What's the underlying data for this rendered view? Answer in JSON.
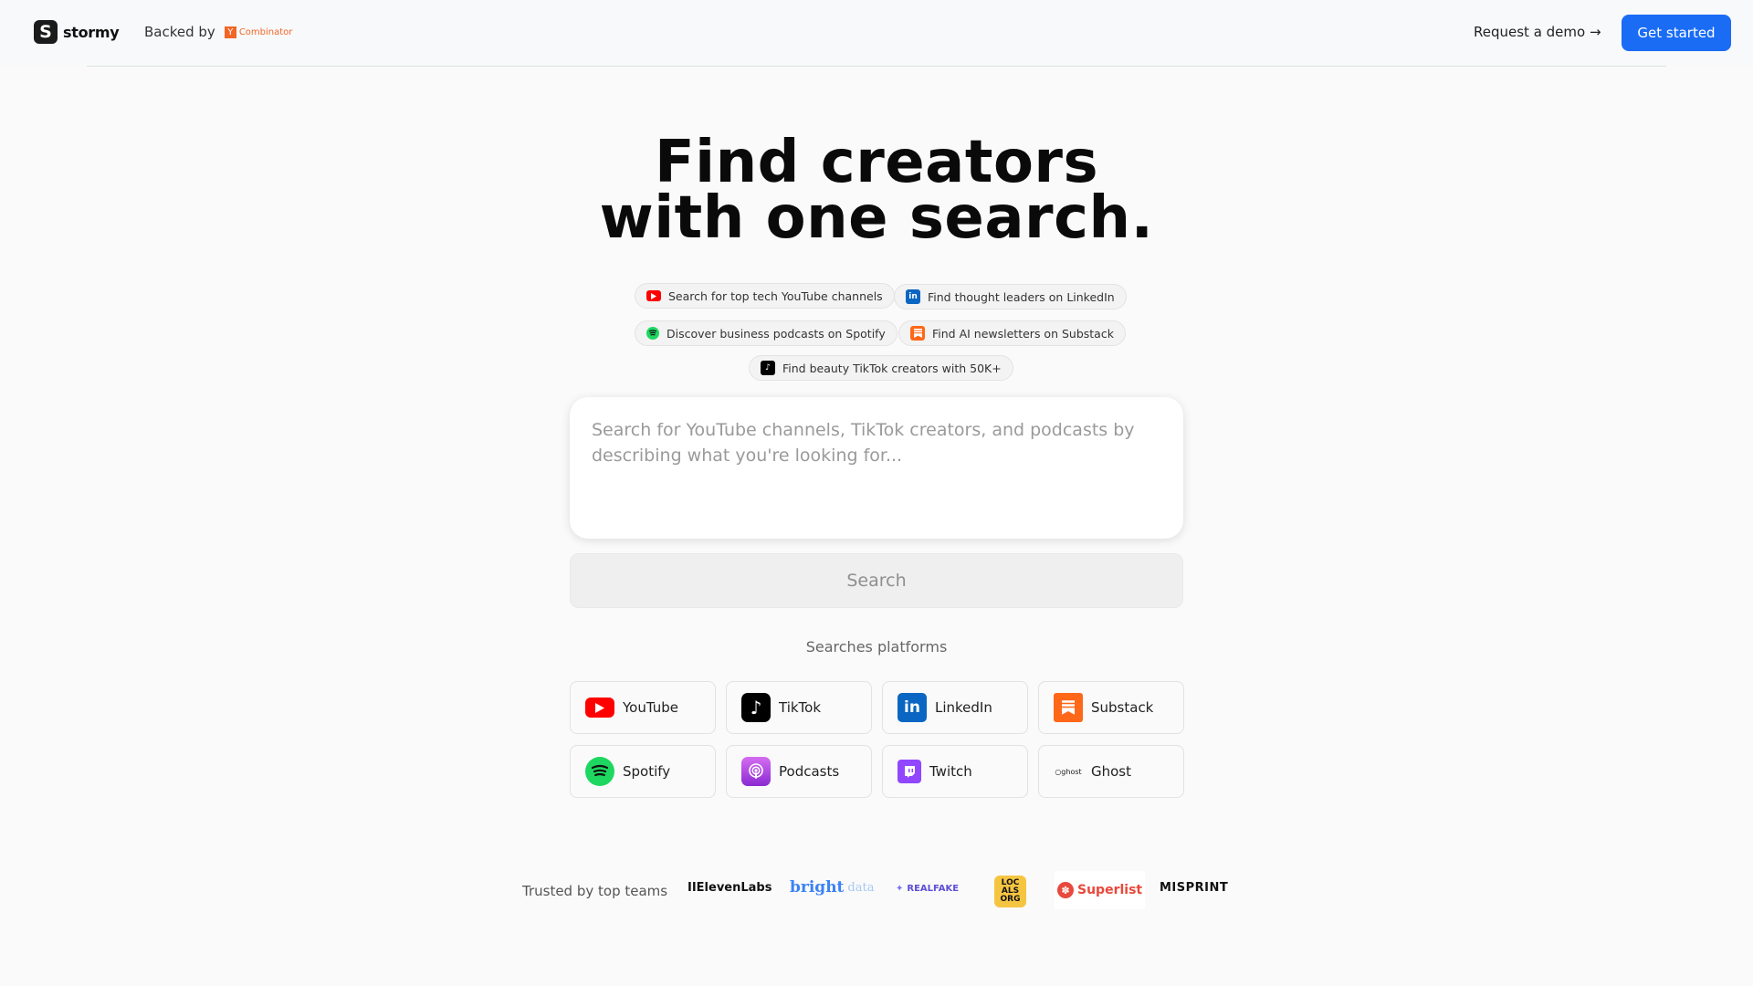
{
  "header": {
    "logo_text": "stormy",
    "logo_mark": "S",
    "backed_label": "Backed by",
    "yc_letter": "Y",
    "yc_text": "Combinator",
    "demo_label": "Request a demo →",
    "cta_label": "Get started"
  },
  "hero": {
    "line1": "Find creators",
    "line2": "with one search."
  },
  "suggestions": [
    {
      "label": "Search for top tech YouTube channels",
      "icon": "youtube-icon"
    },
    {
      "label": "Find thought leaders on LinkedIn",
      "icon": "linkedin-icon"
    },
    {
      "label": "Discover business podcasts on Spotify",
      "icon": "spotify-icon"
    },
    {
      "label": "Find AI newsletters on Substack",
      "icon": "substack-icon"
    },
    {
      "label": "Find beauty TikTok creators with 50K+",
      "icon": "tiktok-icon"
    }
  ],
  "search": {
    "placeholder": "Search for YouTube channels, TikTok creators, and podcasts by describing what you're looking for...",
    "button_label": "Search"
  },
  "platforms": {
    "label": "Searches platforms",
    "items": [
      {
        "label": "YouTube",
        "icon": "youtube-icon",
        "color": "#ff0000"
      },
      {
        "label": "TikTok",
        "icon": "tiktok-icon",
        "color": "#000000"
      },
      {
        "label": "LinkedIn",
        "icon": "linkedin-icon",
        "color": "#0a66c2"
      },
      {
        "label": "Substack",
        "icon": "substack-icon",
        "color": "#ff6719"
      },
      {
        "label": "Spotify",
        "icon": "spotify-icon",
        "color": "#1ed760"
      },
      {
        "label": "Podcasts",
        "icon": "podcasts-icon",
        "color": "#b150e2"
      },
      {
        "label": "Twitch",
        "icon": "twitch-icon",
        "color": "#9146ff"
      },
      {
        "label": "Ghost",
        "icon": "ghost-icon",
        "color": "#15171a"
      }
    ]
  },
  "trusted": {
    "label": "Trusted by top teams",
    "logos": [
      {
        "label": "IIElevenLabs"
      },
      {
        "label": "bright",
        "sub": "data"
      },
      {
        "label": "REALFAKE"
      },
      {
        "label": "LOC ALS ORG"
      },
      {
        "label": "Superlist"
      },
      {
        "label": "MISPRINT"
      }
    ]
  }
}
